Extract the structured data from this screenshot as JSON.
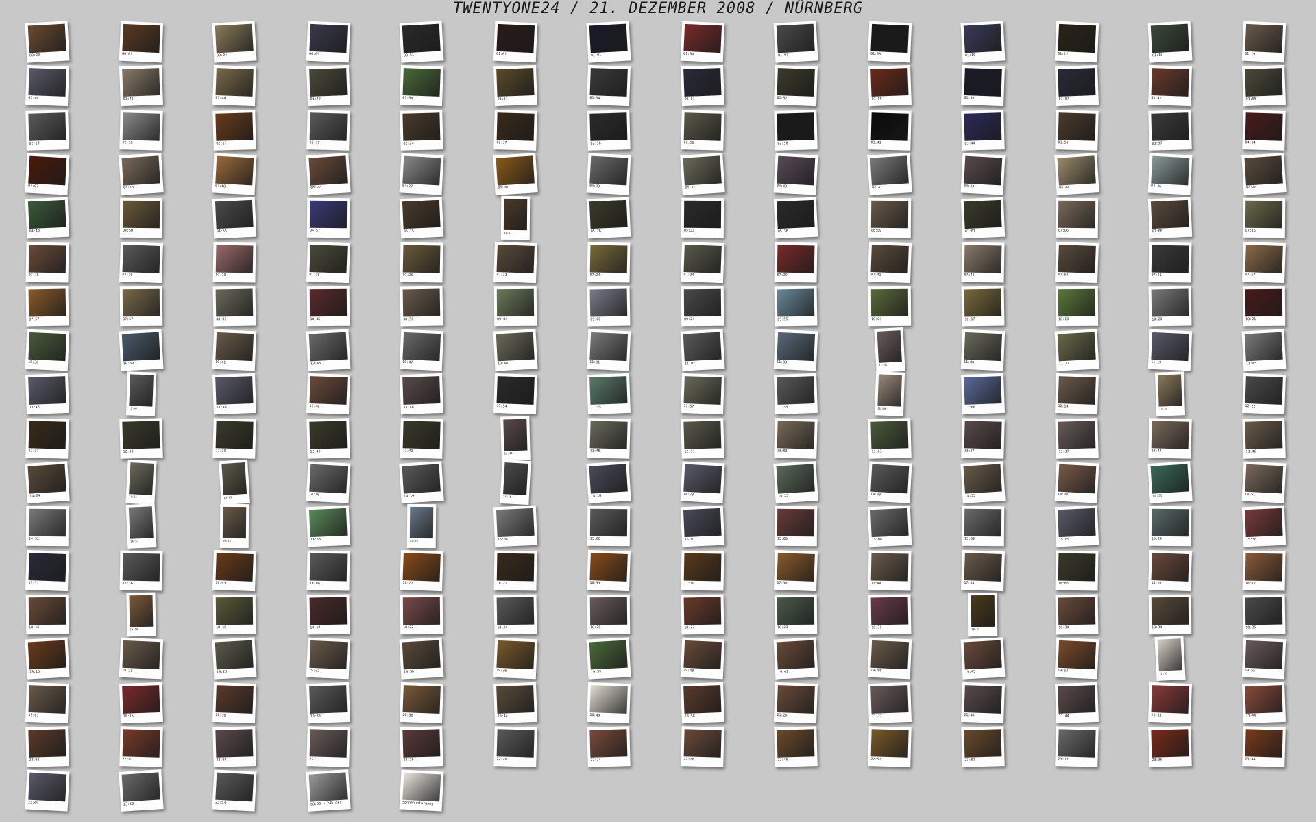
{
  "page": {
    "title": "TWENTYONE24 / 21. DEZEMBER 2008 / NÜRNBERG"
  },
  "grid": {
    "columns": 14,
    "colors": {
      "background": "#c8c8c8",
      "frame": "#fdfdfd"
    }
  },
  "photos": [
    {
      "time": "00:00",
      "tone": "#6a4a30",
      "tall": false
    },
    {
      "time": "00:01",
      "tone": "#5a3a22",
      "tall": false
    },
    {
      "time": "00:04",
      "tone": "#8a7a5a",
      "tall": false
    },
    {
      "time": "00:09",
      "tone": "#3a3a4a",
      "tall": false
    },
    {
      "time": "00:51",
      "tone": "#2a2a2a",
      "tall": false
    },
    {
      "time": "01:01",
      "tone": "#2a1a1a",
      "tall": false
    },
    {
      "time": "01:01",
      "tone": "#1a1a2a",
      "tall": false
    },
    {
      "time": "01:04",
      "tone": "#7a2a2a",
      "tall": false
    },
    {
      "time": "01:07",
      "tone": "#4a4a4a",
      "tall": false
    },
    {
      "time": "01:08",
      "tone": "#1a1a1a",
      "tall": false
    },
    {
      "time": "01:10",
      "tone": "#3a3a5a",
      "tall": false
    },
    {
      "time": "01:12",
      "tone": "#2a2418",
      "tall": false
    },
    {
      "time": "01:13",
      "tone": "#3a4a3a",
      "tall": false
    },
    {
      "time": "01:19",
      "tone": "#6a5a4a",
      "tall": false
    },
    {
      "time": "01:40",
      "tone": "#5a5a6a",
      "tall": false
    },
    {
      "time": "01:41",
      "tone": "#8a7a6a",
      "tall": false
    },
    {
      "time": "01:44",
      "tone": "#7a6a4a",
      "tall": false
    },
    {
      "time": "01:49",
      "tone": "#4a4a3a",
      "tall": false
    },
    {
      "time": "01:56",
      "tone": "#4a6a3a",
      "tall": false
    },
    {
      "time": "01:57",
      "tone": "#5a4a2a",
      "tall": false
    },
    {
      "time": "01:54",
      "tone": "#3a3a3a",
      "tall": false
    },
    {
      "time": "01:51",
      "tone": "#2a2a3a",
      "tall": false
    },
    {
      "time": "01:57",
      "tone": "#3a3a2a",
      "tall": false
    },
    {
      "time": "01:58",
      "tone": "#6a2a1a",
      "tall": false
    },
    {
      "time": "01:56",
      "tone": "#1a1a2a",
      "tall": false
    },
    {
      "time": "01:57",
      "tone": "#2a2a3a",
      "tall": false
    },
    {
      "time": "01:41",
      "tone": "#6a3a2a",
      "tall": false
    },
    {
      "time": "01:58",
      "tone": "#4a4a3a",
      "tall": false
    },
    {
      "time": "02:15",
      "tone": "#5a5a5a",
      "tall": false
    },
    {
      "time": "02:16",
      "tone": "#8a8a8a",
      "tall": false
    },
    {
      "time": "02:17",
      "tone": "#6a3a1a",
      "tall": false
    },
    {
      "time": "02:19",
      "tone": "#5a5a5a",
      "tall": false
    },
    {
      "time": "02:24",
      "tone": "#4a3a2a",
      "tall": false
    },
    {
      "time": "02:37",
      "tone": "#3a2a1a",
      "tall": false
    },
    {
      "time": "02:38",
      "tone": "#2a2a2a",
      "tall": false
    },
    {
      "time": "02:56",
      "tone": "#5a5a4a",
      "tall": false
    },
    {
      "time": "02:58",
      "tone": "#1a1a1a",
      "tall": false
    },
    {
      "time": "03:43",
      "tone": "#0a0a0a",
      "tall": false
    },
    {
      "time": "03:44",
      "tone": "#2a2a5a",
      "tall": false
    },
    {
      "time": "03:50",
      "tone": "#4a3a2a",
      "tall": false
    },
    {
      "time": "03:57",
      "tone": "#3a3a3a",
      "tall": false
    },
    {
      "time": "04:04",
      "tone": "#4a1a1a",
      "tall": false
    },
    {
      "time": "04:07",
      "tone": "#4a1a0a",
      "tall": false
    },
    {
      "time": "04:16",
      "tone": "#7a6a5a",
      "tall": false
    },
    {
      "time": "04:18",
      "tone": "#9a6a3a",
      "tall": false
    },
    {
      "time": "04:22",
      "tone": "#6a4a3a",
      "tall": false
    },
    {
      "time": "04:27",
      "tone": "#8a8a8a",
      "tall": false
    },
    {
      "time": "04:30",
      "tone": "#8a5a1a",
      "tall": false
    },
    {
      "time": "04:30",
      "tone": "#6a6a6a",
      "tall": false
    },
    {
      "time": "04:37",
      "tone": "#6a6a5a",
      "tall": false
    },
    {
      "time": "04:40",
      "tone": "#5a4a5a",
      "tall": false
    },
    {
      "time": "04:41",
      "tone": "#7a7a7a",
      "tall": false
    },
    {
      "time": "04:43",
      "tone": "#5a4a4a",
      "tall": false
    },
    {
      "time": "04:44",
      "tone": "#9a8a6a",
      "tall": false
    },
    {
      "time": "04:46",
      "tone": "#8a9a9a",
      "tall": false
    },
    {
      "time": "04:48",
      "tone": "#5a4a3a",
      "tall": false
    },
    {
      "time": "04:49",
      "tone": "#3a5a3a",
      "tall": false
    },
    {
      "time": "04:50",
      "tone": "#6a5a3a",
      "tall": false
    },
    {
      "time": "04:55",
      "tone": "#4a4a4a",
      "tall": false
    },
    {
      "time": "04:57",
      "tone": "#3a3a7a",
      "tall": false
    },
    {
      "time": "05:15",
      "tone": "#4a3a2a",
      "tall": false
    },
    {
      "time": "05:17",
      "tone": "#4a3a2a",
      "tall": true
    },
    {
      "time": "05:26",
      "tone": "#3a3a2a",
      "tall": false
    },
    {
      "time": "05:33",
      "tone": "#2a2a2a",
      "tall": false
    },
    {
      "time": "05:36",
      "tone": "#2a2a2a",
      "tall": false
    },
    {
      "time": "06:59",
      "tone": "#6a5a4a",
      "tall": false
    },
    {
      "time": "07:01",
      "tone": "#3a3a2a",
      "tall": false
    },
    {
      "time": "07:05",
      "tone": "#7a6a5a",
      "tall": false
    },
    {
      "time": "07:08",
      "tone": "#5a4a3a",
      "tall": false
    },
    {
      "time": "07:15",
      "tone": "#6a6a4a",
      "tall": false
    },
    {
      "time": "07:15",
      "tone": "#6a4a3a",
      "tall": false
    },
    {
      "time": "07:16",
      "tone": "#5a5a5a",
      "tall": false
    },
    {
      "time": "07:18",
      "tone": "#9a6a6a",
      "tall": false
    },
    {
      "time": "07:19",
      "tone": "#4a4a3a",
      "tall": false
    },
    {
      "time": "07:20",
      "tone": "#6a5a3a",
      "tall": false
    },
    {
      "time": "07:22",
      "tone": "#5a4a3a",
      "tall": false
    },
    {
      "time": "07:24",
      "tone": "#7a6a3a",
      "tall": false
    },
    {
      "time": "07:24",
      "tone": "#5a5a4a",
      "tall": false
    },
    {
      "time": "07:29",
      "tone": "#7a2a2a",
      "tall": false
    },
    {
      "time": "07:41",
      "tone": "#5a4a3a",
      "tall": false
    },
    {
      "time": "07:45",
      "tone": "#8a7a6a",
      "tall": false
    },
    {
      "time": "07:50",
      "tone": "#5a4a3a",
      "tall": false
    },
    {
      "time": "07:51",
      "tone": "#3a3a3a",
      "tall": false
    },
    {
      "time": "07:57",
      "tone": "#8a6a4a",
      "tall": false
    },
    {
      "time": "07:57",
      "tone": "#8a5a2a",
      "tall": false
    },
    {
      "time": "07:57",
      "tone": "#7a6a4a",
      "tall": false
    },
    {
      "time": "08:01",
      "tone": "#6a6a5a",
      "tall": false
    },
    {
      "time": "08:46",
      "tone": "#5a2a2a",
      "tall": false
    },
    {
      "time": "08:56",
      "tone": "#6a5a4a",
      "tall": false
    },
    {
      "time": "09:04",
      "tone": "#6a7a5a",
      "tall": false
    },
    {
      "time": "09:08",
      "tone": "#7a7a8a",
      "tall": false
    },
    {
      "time": "09:24",
      "tone": "#4a4a4a",
      "tall": false
    },
    {
      "time": "09:55",
      "tone": "#6a8a9a",
      "tall": false
    },
    {
      "time": "10:04",
      "tone": "#5a6a3a",
      "tall": false
    },
    {
      "time": "10:17",
      "tone": "#7a6a3a",
      "tall": false
    },
    {
      "time": "10:18",
      "tone": "#5a7a3a",
      "tall": false
    },
    {
      "time": "10:20",
      "tone": "#7a7a7a",
      "tall": false
    },
    {
      "time": "10:21",
      "tone": "#4a1a1a",
      "tall": false
    },
    {
      "time": "10:38",
      "tone": "#4a5a3a",
      "tall": false
    },
    {
      "time": "10:39",
      "tone": "#4a5a6a",
      "tall": false
    },
    {
      "time": "10:41",
      "tone": "#6a5a4a",
      "tall": false
    },
    {
      "time": "10:46",
      "tone": "#6a6a6a",
      "tall": false
    },
    {
      "time": "10:47",
      "tone": "#6a6a6a",
      "tall": false
    },
    {
      "time": "10:48",
      "tone": "#6a6a5a",
      "tall": false
    },
    {
      "time": "11:01",
      "tone": "#7a7a7a",
      "tall": false
    },
    {
      "time": "11:02",
      "tone": "#5a5a5a",
      "tall": false
    },
    {
      "time": "11:03",
      "tone": "#5a6a7a",
      "tall": false
    },
    {
      "time": "11:06",
      "tone": "#6a5a5a",
      "tall": true
    },
    {
      "time": "11:08",
      "tone": "#6a6a5a",
      "tall": false
    },
    {
      "time": "11:17",
      "tone": "#6a6a4a",
      "tall": false
    },
    {
      "time": "11:19",
      "tone": "#5a5a6a",
      "tall": false
    },
    {
      "time": "11:45",
      "tone": "#7a7a7a",
      "tall": false
    },
    {
      "time": "11:46",
      "tone": "#5a5a6a",
      "tall": false
    },
    {
      "time": "11:47",
      "tone": "#5a5a5a",
      "tall": true
    },
    {
      "time": "11:48",
      "tone": "#5a5a6a",
      "tall": false
    },
    {
      "time": "11:48",
      "tone": "#6a4a3a",
      "tall": false
    },
    {
      "time": "11:48",
      "tone": "#5a4a4a",
      "tall": false
    },
    {
      "time": "11:54",
      "tone": "#2a2a2a",
      "tall": false
    },
    {
      "time": "11:55",
      "tone": "#5a7a6a",
      "tall": false
    },
    {
      "time": "11:57",
      "tone": "#6a6a5a",
      "tall": false
    },
    {
      "time": "11:59",
      "tone": "#5a5a5a",
      "tall": false
    },
    {
      "time": "12:00",
      "tone": "#9a8a7a",
      "tall": true
    },
    {
      "time": "12:00",
      "tone": "#5a6a9a",
      "tall": false
    },
    {
      "time": "12:14",
      "tone": "#6a5a4a",
      "tall": false
    },
    {
      "time": "12:20",
      "tone": "#8a7a5a",
      "tall": true
    },
    {
      "time": "12:22",
      "tone": "#4a4a4a",
      "tall": false
    },
    {
      "time": "12:37",
      "tone": "#3a2a1a",
      "tall": false
    },
    {
      "time": "12:38",
      "tone": "#3a3a2a",
      "tall": false
    },
    {
      "time": "12:39",
      "tone": "#3a3a2a",
      "tall": false
    },
    {
      "time": "12:40",
      "tone": "#3a3a2a",
      "tall": false
    },
    {
      "time": "12:42",
      "tone": "#3a3a2a",
      "tall": false
    },
    {
      "time": "12:44",
      "tone": "#5a4a4a",
      "tall": true
    },
    {
      "time": "12:45",
      "tone": "#6a6a5a",
      "tall": false
    },
    {
      "time": "12:51",
      "tone": "#5a5a4a",
      "tall": false
    },
    {
      "time": "13:02",
      "tone": "#7a6a5a",
      "tall": false
    },
    {
      "time": "13:03",
      "tone": "#4a5a3a",
      "tall": false
    },
    {
      "time": "13:17",
      "tone": "#5a4a4a",
      "tall": false
    },
    {
      "time": "13:37",
      "tone": "#6a5a5a",
      "tall": false
    },
    {
      "time": "13:44",
      "tone": "#7a6a5a",
      "tall": false
    },
    {
      "time": "13:46",
      "tone": "#6a5a4a",
      "tall": false
    },
    {
      "time": "14:04",
      "tone": "#5a4a3a",
      "tall": false
    },
    {
      "time": "14:05",
      "tone": "#6a6a5a",
      "tall": true
    },
    {
      "time": "14:09",
      "tone": "#5a5a4a",
      "tall": true
    },
    {
      "time": "14:10",
      "tone": "#6a6a6a",
      "tall": false
    },
    {
      "time": "14:14",
      "tone": "#5a5a5a",
      "tall": false
    },
    {
      "time": "14:15",
      "tone": "#4a4a4a",
      "tall": true
    },
    {
      "time": "14:18",
      "tone": "#4a4a5a",
      "tall": false
    },
    {
      "time": "14:20",
      "tone": "#5a5a6a",
      "tall": false
    },
    {
      "time": "14:23",
      "tone": "#5a6a5a",
      "tall": false
    },
    {
      "time": "14:30",
      "tone": "#5a5a5a",
      "tall": false
    },
    {
      "time": "14:35",
      "tone": "#6a5a4a",
      "tall": false
    },
    {
      "time": "14:38",
      "tone": "#7a5a4a",
      "tall": false
    },
    {
      "time": "14:38",
      "tone": "#3a6a5a",
      "tall": false
    },
    {
      "time": "14:51",
      "tone": "#7a6a5a",
      "tall": false
    },
    {
      "time": "14:52",
      "tone": "#7a7a7a",
      "tall": false
    },
    {
      "time": "14:53",
      "tone": "#7a7a7a",
      "tall": true
    },
    {
      "time": "14:55",
      "tone": "#6a5a4a",
      "tall": true
    },
    {
      "time": "14:58",
      "tone": "#5a8a5a",
      "tall": false
    },
    {
      "time": "15:03",
      "tone": "#6a7a8a",
      "tall": true
    },
    {
      "time": "15:04",
      "tone": "#7a7a7a",
      "tall": false
    },
    {
      "time": "15:06",
      "tone": "#5a5a5a",
      "tall": false
    },
    {
      "time": "15:07",
      "tone": "#4a4a5a",
      "tall": false
    },
    {
      "time": "15:08",
      "tone": "#6a3a3a",
      "tall": false
    },
    {
      "time": "15:08",
      "tone": "#6a6a6a",
      "tall": false
    },
    {
      "time": "15:09",
      "tone": "#6a6a6a",
      "tall": false
    },
    {
      "time": "15:09",
      "tone": "#5a5a6a",
      "tall": false
    },
    {
      "time": "15:24",
      "tone": "#5a6a6a",
      "tall": false
    },
    {
      "time": "15:30",
      "tone": "#7a3a3a",
      "tall": false
    },
    {
      "time": "15:31",
      "tone": "#2a2a3a",
      "tall": false
    },
    {
      "time": "15:36",
      "tone": "#5a5a5a",
      "tall": false
    },
    {
      "time": "16:03",
      "tone": "#6a3a1a",
      "tall": false
    },
    {
      "time": "16:08",
      "tone": "#5a5a5a",
      "tall": false
    },
    {
      "time": "16:21",
      "tone": "#8a4a1a",
      "tall": false
    },
    {
      "time": "16:22",
      "tone": "#3a2a1a",
      "tall": false
    },
    {
      "time": "16:53",
      "tone": "#8a4a1a",
      "tall": false
    },
    {
      "time": "17:10",
      "tone": "#5a3a1a",
      "tall": false
    },
    {
      "time": "17:30",
      "tone": "#8a5a2a",
      "tall": false
    },
    {
      "time": "17:44",
      "tone": "#6a5a4a",
      "tall": false
    },
    {
      "time": "17:54",
      "tone": "#6a5a4a",
      "tall": false
    },
    {
      "time": "18:05",
      "tone": "#3a3a2a",
      "tall": false
    },
    {
      "time": "18:10",
      "tone": "#6a4a3a",
      "tall": false
    },
    {
      "time": "18:12",
      "tone": "#8a5a3a",
      "tall": false
    },
    {
      "time": "18:16",
      "tone": "#6a4a3a",
      "tall": false
    },
    {
      "time": "18:18",
      "tone": "#7a5a3a",
      "tall": true
    },
    {
      "time": "18:18",
      "tone": "#5a5a3a",
      "tall": false
    },
    {
      "time": "18:19",
      "tone": "#4a2a2a",
      "tall": false
    },
    {
      "time": "18:22",
      "tone": "#7a4a4a",
      "tall": false
    },
    {
      "time": "18:24",
      "tone": "#5a5a5a",
      "tall": false
    },
    {
      "time": "18:26",
      "tone": "#6a5a5a",
      "tall": false
    },
    {
      "time": "18:27",
      "tone": "#6a3a2a",
      "tall": false
    },
    {
      "time": "18:28",
      "tone": "#4a5a4a",
      "tall": false
    },
    {
      "time": "18:31",
      "tone": "#6a3a4a",
      "tall": false
    },
    {
      "time": "18:33",
      "tone": "#4a3a1a",
      "tall": true
    },
    {
      "time": "18:34",
      "tone": "#6a4a3a",
      "tall": false
    },
    {
      "time": "18:34",
      "tone": "#5a4a3a",
      "tall": false
    },
    {
      "time": "18:35",
      "tone": "#4a4a4a",
      "tall": false
    },
    {
      "time": "19:16",
      "tone": "#6a3a1a",
      "tall": false
    },
    {
      "time": "19:21",
      "tone": "#6a5a4a",
      "tall": false
    },
    {
      "time": "19:23",
      "tone": "#5a5a4a",
      "tall": false
    },
    {
      "time": "19:32",
      "tone": "#6a5a4a",
      "tall": false
    },
    {
      "time": "19:36",
      "tone": "#5a4a3a",
      "tall": false
    },
    {
      "time": "19:36",
      "tone": "#7a5a2a",
      "tall": false
    },
    {
      "time": "19:39",
      "tone": "#4a6a3a",
      "tall": false
    },
    {
      "time": "19:40",
      "tone": "#6a4a3a",
      "tall": false
    },
    {
      "time": "19:41",
      "tone": "#6a4a3a",
      "tall": false
    },
    {
      "time": "19:44",
      "tone": "#6a5a4a",
      "tall": false
    },
    {
      "time": "19:45",
      "tone": "#6a4a3a",
      "tall": false
    },
    {
      "time": "19:52",
      "tone": "#7a4a2a",
      "tall": false
    },
    {
      "time": "19:55",
      "tone": "#d8d0c8",
      "tall": true
    },
    {
      "time": "19:55",
      "tone": "#6a5a5a",
      "tall": false
    },
    {
      "time": "19:63",
      "tone": "#6a5a4a",
      "tall": false
    },
    {
      "time": "20:16",
      "tone": "#7a2a2a",
      "tall": false
    },
    {
      "time": "20:16",
      "tone": "#5a3a2a",
      "tall": false
    },
    {
      "time": "20:30",
      "tone": "#5a5a5a",
      "tall": false
    },
    {
      "time": "20:36",
      "tone": "#7a5a3a",
      "tall": false
    },
    {
      "time": "20:44",
      "tone": "#5a4a3a",
      "tall": false
    },
    {
      "time": "20:49",
      "tone": "#e0dcd0",
      "tall": false
    },
    {
      "time": "20:58",
      "tone": "#5a3a2a",
      "tall": false
    },
    {
      "time": "21:20",
      "tone": "#6a4a3a",
      "tall": false
    },
    {
      "time": "21:27",
      "tone": "#6a5a5a",
      "tall": false
    },
    {
      "time": "21:40",
      "tone": "#5a4a4a",
      "tall": false
    },
    {
      "time": "21:44",
      "tone": "#5a4a4a",
      "tall": false
    },
    {
      "time": "21:53",
      "tone": "#8a3a3a",
      "tall": false
    },
    {
      "time": "21:59",
      "tone": "#8a4a3a",
      "tall": false
    },
    {
      "time": "22:01",
      "tone": "#5a3a2a",
      "tall": false
    },
    {
      "time": "22:07",
      "tone": "#7a3a2a",
      "tall": false
    },
    {
      "time": "22:08",
      "tone": "#5a4a4a",
      "tall": false
    },
    {
      "time": "22:11",
      "tone": "#6a5a5a",
      "tall": false
    },
    {
      "time": "22:16",
      "tone": "#5a3a3a",
      "tall": false
    },
    {
      "time": "22:20",
      "tone": "#5a5a5a",
      "tall": false
    },
    {
      "time": "22:24",
      "tone": "#7a4a3a",
      "tall": false
    },
    {
      "time": "22:26",
      "tone": "#6a4a3a",
      "tall": false
    },
    {
      "time": "22:49",
      "tone": "#6a4a2a",
      "tall": false
    },
    {
      "time": "22:57",
      "tone": "#7a5a2a",
      "tall": false
    },
    {
      "time": "23:01",
      "tone": "#6a4a2a",
      "tall": false
    },
    {
      "time": "23:13",
      "tone": "#6a6a6a",
      "tall": false
    },
    {
      "time": "23:36",
      "tone": "#7a2a1a",
      "tall": false
    },
    {
      "time": "23:44",
      "tone": "#7a3a1a",
      "tall": false
    },
    {
      "time": "23:49",
      "tone": "#5a5a6a",
      "tall": false
    },
    {
      "time": "23:50",
      "tone": "#6a6a6a",
      "tall": false
    },
    {
      "time": "23:53",
      "tone": "#5a5a5a",
      "tall": false
    },
    {
      "time": "00:00 → 24h ok!",
      "tone": "#9a9a9a",
      "tall": false
    },
    {
      "time": "Sonnenuntergang",
      "tone": "#e8e4dc",
      "tall": false
    }
  ]
}
